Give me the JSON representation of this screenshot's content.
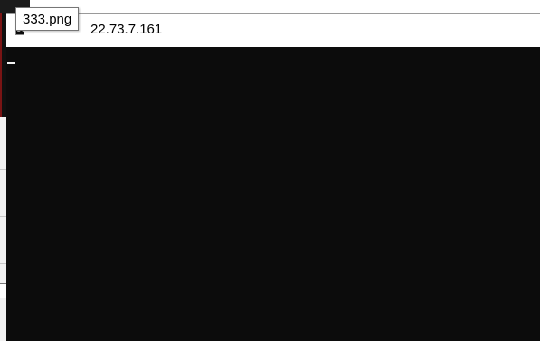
{
  "console_window": {
    "title": "22.73.7.161",
    "icon": "console-icon",
    "icon_glyph": "C:"
  },
  "tooltip": {
    "text": "333.png"
  },
  "colors": {
    "console_background": "#0c0c0c",
    "title_bar_background": "#ffffff",
    "cursor": "#f2f2f2"
  }
}
